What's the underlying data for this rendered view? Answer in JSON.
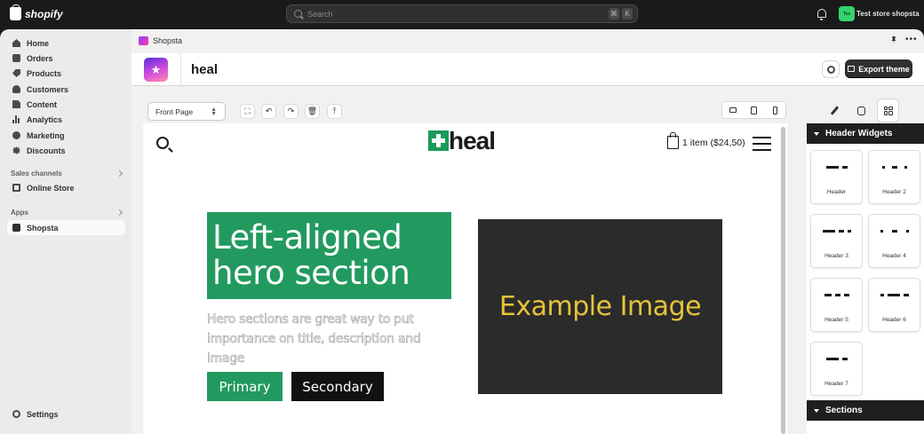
{
  "topbar": {
    "brand": "shopify",
    "search_placeholder": "Search",
    "kbd_cmd": "⌘",
    "kbd_k": "K",
    "avatar_initials": "Tes",
    "store_name": "Test store shopsta"
  },
  "sidebar": {
    "items": [
      {
        "label": "Home"
      },
      {
        "label": "Orders"
      },
      {
        "label": "Products"
      },
      {
        "label": "Customers"
      },
      {
        "label": "Content"
      },
      {
        "label": "Analytics"
      },
      {
        "label": "Marketing"
      },
      {
        "label": "Discounts"
      }
    ],
    "sales_channels_label": "Sales channels",
    "online_store_label": "Online Store",
    "apps_label": "Apps",
    "shopsta_label": "Shopsta",
    "settings_label": "Settings"
  },
  "app_header": {
    "breadcrumb": "Shopsta",
    "title": "heal",
    "export_label": "Export theme"
  },
  "editor": {
    "page_select_value": "Front Page"
  },
  "site": {
    "brand": "heal",
    "cart_text": "1 item ($24,50)",
    "hero_title_line1": "Left-aligned",
    "hero_title_line2": "hero section",
    "hero_desc": "Hero sections are great way to put importance on title, description and image",
    "primary_label": "Primary",
    "secondary_label": "Secondary",
    "image_placeholder": "Example Image"
  },
  "panel": {
    "header_widgets_label": "Header Widgets",
    "sections_label": "Sections",
    "widgets": [
      {
        "label": "Header"
      },
      {
        "label": "Header 2"
      },
      {
        "label": "Header 3"
      },
      {
        "label": "Header 4"
      },
      {
        "label": "Header 5"
      },
      {
        "label": "Header 6"
      },
      {
        "label": "Header 7"
      }
    ]
  },
  "colors": {
    "brand_green": "#229a5f",
    "image_text": "#e7c33a",
    "topbar": "#1a1a1a"
  }
}
